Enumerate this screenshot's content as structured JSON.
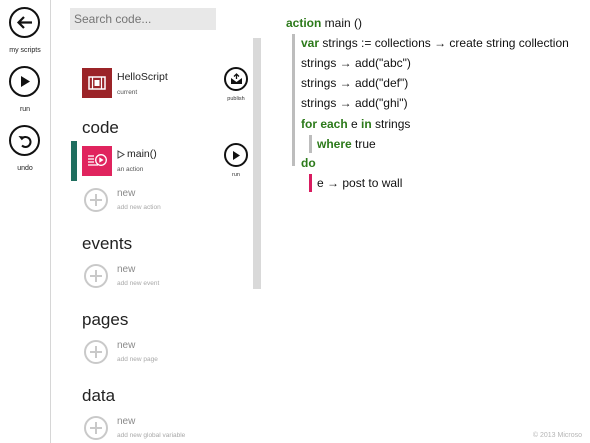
{
  "rail": {
    "my_scripts_label": "my scripts",
    "run_label": "run",
    "undo_label": "undo"
  },
  "search": {
    "placeholder": "Search code..."
  },
  "script": {
    "title": "HelloScript",
    "subtitle": "current",
    "publish_label": "publish",
    "run_label": "run"
  },
  "sections": {
    "code": {
      "heading": "code",
      "action_name": "main()",
      "action_sub": "an action",
      "new_title": "new",
      "new_sub": "add new action"
    },
    "events": {
      "heading": "events",
      "new_title": "new",
      "new_sub": "add new event"
    },
    "pages": {
      "heading": "pages",
      "new_title": "new",
      "new_sub": "add new page"
    },
    "data": {
      "heading": "data",
      "new_title": "new",
      "new_sub": "add new global variable"
    }
  },
  "editor": {
    "l1_kw": "action",
    "l1_rest": " main ()",
    "l2_kw": "var",
    "l2_rest": " strings := collections → create string collection",
    "l3": "strings → add(\"abc\")",
    "l4": "strings → add(\"def\")",
    "l5": "strings → add(\"ghi\")",
    "l6_kw1": "for each",
    "l6_mid": " e ",
    "l6_kw2": "in",
    "l6_rest": " strings",
    "l7_kw": "where",
    "l7_rest": " true",
    "l8_kw": "do",
    "l9": "e → post to wall"
  },
  "footer": {
    "copyright": "© 2013 Microso"
  },
  "colors": {
    "keyword": "#2c7a1a",
    "script_thumb": "#9b2428",
    "action_thumb": "#e0245e",
    "selection_bar": "#1f6e5f",
    "error_marker": "#d81b60"
  }
}
